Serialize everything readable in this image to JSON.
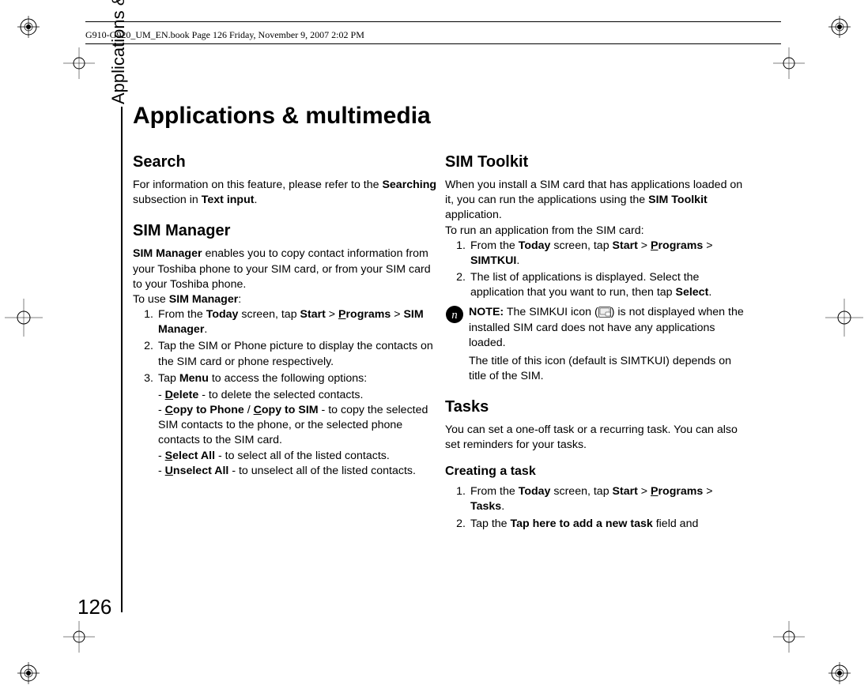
{
  "header": "G910-G920_UM_EN.book  Page 126  Friday, November 9, 2007  2:02 PM",
  "sideTab": "Applications & multimedia",
  "pageNumber": "126",
  "title": "Applications & multimedia",
  "col1": {
    "search": {
      "heading": "Search"
    },
    "searchBody": {
      "a": "For information on this feature, please refer to the ",
      "b": "Searching",
      "c": " subsection in ",
      "d": "Text input",
      "e": "."
    },
    "sim": {
      "heading": "SIM Manager"
    },
    "simIntro": {
      "a": "SIM Manager",
      "b": " enables you to copy contact information from your Toshiba phone to your SIM card, or from your SIM card to your Toshiba phone."
    },
    "simUse": {
      "a": "To use ",
      "b": "SIM Manager",
      "c": ":"
    },
    "i1": {
      "n": "1.",
      "a": "From the ",
      "b": "Today",
      "c": " screen, tap ",
      "d": "Start",
      "e": " > ",
      "pU": "P",
      "prog": "rograms",
      "f": " > ",
      "g": "SIM Manager",
      "h": "."
    },
    "i2": {
      "n": "2.",
      "a": "Tap the SIM or Phone picture to display the contacts on the SIM card or phone respectively."
    },
    "i3": {
      "n": "3.",
      "a": "Tap ",
      "b": "Menu",
      "c": " to access the following options:"
    },
    "i3a": {
      "dash": "- ",
      "dU": "D",
      "del": "elete",
      "tail": " - to delete the selected contacts."
    },
    "i3b": {
      "dash": "- ",
      "cU": "C",
      "cop": "opy to Phone",
      "slash": " / ",
      "cU2": "C",
      "cop2": "opy to SIM",
      "tail": " - to copy the selected SIM contacts to the phone, or the selected phone contacts to the SIM card."
    },
    "i3c": {
      "dash": "- ",
      "sU": "S",
      "sel": "elect All",
      "tail": " - to select all of the listed contacts."
    },
    "i3d": {
      "dash": "- ",
      "uU": "U",
      "un": "nselect All",
      "tail": " - to unselect all of the listed contacts."
    }
  },
  "col2": {
    "stk": {
      "heading": "SIM Toolkit"
    },
    "stkIntro": {
      "a": "When you install a SIM card that has applications loaded on it, you can run the applications using the ",
      "b": "SIM Toolkit",
      "c": " application."
    },
    "stkRun": "To run an application from the SIM card:",
    "i1": {
      "n": "1.",
      "a": "From the ",
      "b": "Today",
      "c": " screen, tap ",
      "d": "Start",
      "e": " > ",
      "pU": "P",
      "prog": "rograms",
      "f": " > ",
      "g": "SIMTKUI",
      "h": "."
    },
    "i2": {
      "n": "2.",
      "a": "The list of applications is displayed. Select the application that you want to run, then tap ",
      "b": "Select",
      "c": "."
    },
    "note": {
      "lbl": "NOTE:",
      "a": " The SIMKUI icon (",
      "iconChar": " ",
      "b": ") is not displayed when the installed SIM card does not have any applications loaded."
    },
    "note2": "The title of this icon (default is SIMTKUI) depends on title of the SIM.",
    "tasks": {
      "heading": "Tasks"
    },
    "tasksIntro": "You can set a one-off task or a recurring task. You can also set reminders for your tasks.",
    "creating": {
      "heading": "Creating a task"
    },
    "t1": {
      "n": "1.",
      "a": "From the ",
      "b": "Today",
      "c": " screen, tap ",
      "d": "Start",
      "e": " > ",
      "pU": "P",
      "prog": "rograms",
      "f": " > ",
      "g": "Tasks",
      "h": "."
    },
    "t2": {
      "n": "2.",
      "a": "Tap the ",
      "b": "Tap here to add a new task",
      "c": " field and"
    }
  }
}
